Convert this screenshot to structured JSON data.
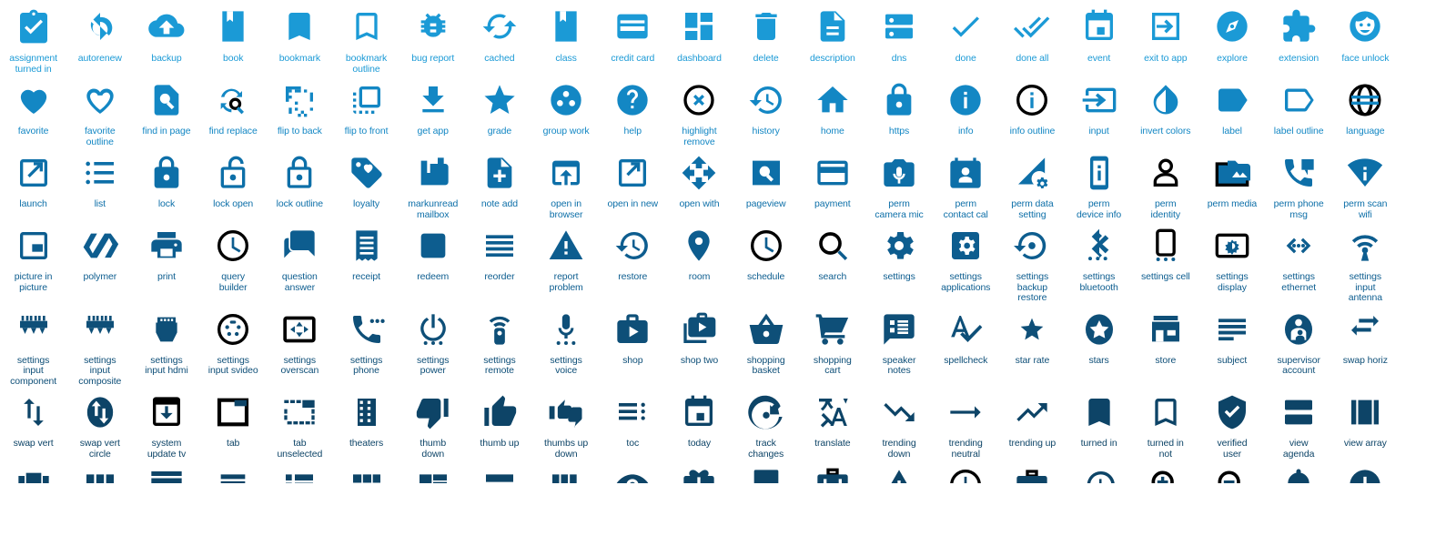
{
  "sheet": {
    "title": "Icon set reference sheet",
    "columns": 21,
    "accent_top": "#1b9ad6",
    "accent_bottom": "#0d4467",
    "background": "#ffffff"
  },
  "rows": [
    {
      "index": 0,
      "color": "#1b9ad6",
      "icons": [
        {
          "name": "assignment-turned-in",
          "label": "assignment\nturned in",
          "glyph": "clipboard-check"
        },
        {
          "name": "autorenew",
          "label": "autorenew",
          "glyph": "autorenew"
        },
        {
          "name": "backup",
          "label": "backup",
          "glyph": "cloud-upload"
        },
        {
          "name": "book",
          "label": "book",
          "glyph": "book"
        },
        {
          "name": "bookmark",
          "label": "bookmark",
          "glyph": "bookmark"
        },
        {
          "name": "bookmark-outline",
          "label": "bookmark\noutline",
          "glyph": "bookmark-outline"
        },
        {
          "name": "bug-report",
          "label": "bug report",
          "glyph": "bug"
        },
        {
          "name": "cached",
          "label": "cached",
          "glyph": "cached"
        },
        {
          "name": "class",
          "label": "class",
          "glyph": "book"
        },
        {
          "name": "credit-card",
          "label": "credit card",
          "glyph": "credit-card"
        },
        {
          "name": "dashboard",
          "label": "dashboard",
          "glyph": "dashboard"
        },
        {
          "name": "delete",
          "label": "delete",
          "glyph": "trash"
        },
        {
          "name": "description",
          "label": "description",
          "glyph": "document"
        },
        {
          "name": "dns",
          "label": "dns",
          "glyph": "dns"
        },
        {
          "name": "done",
          "label": "done",
          "glyph": "check"
        },
        {
          "name": "done-all",
          "label": "done all",
          "glyph": "check-double"
        },
        {
          "name": "event",
          "label": "event",
          "glyph": "calendar-event"
        },
        {
          "name": "exit-to-app",
          "label": "exit to app",
          "glyph": "exit-to-app"
        },
        {
          "name": "explore",
          "label": "explore",
          "glyph": "compass"
        },
        {
          "name": "extension",
          "label": "extension",
          "glyph": "puzzle"
        },
        {
          "name": "face-unlock",
          "label": "face unlock",
          "glyph": "face"
        }
      ]
    },
    {
      "index": 1,
      "color": "#1387c4",
      "icons": [
        {
          "name": "favorite",
          "label": "favorite",
          "glyph": "heart"
        },
        {
          "name": "favorite-outline",
          "label": "favorite\noutline",
          "glyph": "heart-outline"
        },
        {
          "name": "find-in-page",
          "label": "find in page",
          "glyph": "find-in-page"
        },
        {
          "name": "find-replace",
          "label": "find replace",
          "glyph": "find-replace"
        },
        {
          "name": "flip-to-back",
          "label": "flip to back",
          "glyph": "flip-to-back"
        },
        {
          "name": "flip-to-front",
          "label": "flip to front",
          "glyph": "flip-to-front"
        },
        {
          "name": "get-app",
          "label": "get app",
          "glyph": "download"
        },
        {
          "name": "grade",
          "label": "grade",
          "glyph": "star"
        },
        {
          "name": "group-work",
          "label": "group work",
          "glyph": "group-work"
        },
        {
          "name": "help",
          "label": "help",
          "glyph": "help"
        },
        {
          "name": "highlight-remove",
          "label": "highlight\nremove",
          "glyph": "highlight-remove"
        },
        {
          "name": "history",
          "label": "history",
          "glyph": "history"
        },
        {
          "name": "home",
          "label": "home",
          "glyph": "home"
        },
        {
          "name": "https",
          "label": "https",
          "glyph": "lock"
        },
        {
          "name": "info",
          "label": "info",
          "glyph": "info"
        },
        {
          "name": "info-outline",
          "label": "info outline",
          "glyph": "info-outline"
        },
        {
          "name": "input",
          "label": "input",
          "glyph": "input"
        },
        {
          "name": "invert-colors",
          "label": "invert colors",
          "glyph": "invert-colors"
        },
        {
          "name": "label",
          "label": "label",
          "glyph": "label"
        },
        {
          "name": "label-outline",
          "label": "label outline",
          "glyph": "label-outline"
        },
        {
          "name": "language",
          "label": "language",
          "glyph": "globe"
        }
      ]
    },
    {
      "index": 2,
      "color": "#0d6fa8",
      "icons": [
        {
          "name": "launch",
          "label": "launch",
          "glyph": "launch"
        },
        {
          "name": "list",
          "label": "list",
          "glyph": "list"
        },
        {
          "name": "lock",
          "label": "lock",
          "glyph": "lock"
        },
        {
          "name": "lock-open",
          "label": "lock open",
          "glyph": "lock-open"
        },
        {
          "name": "lock-outline",
          "label": "lock outline",
          "glyph": "lock-outline"
        },
        {
          "name": "loyalty",
          "label": "loyalty",
          "glyph": "loyalty"
        },
        {
          "name": "markunread-mailbox",
          "label": "markunread\nmailbox",
          "glyph": "mailbox"
        },
        {
          "name": "note-add",
          "label": "note add",
          "glyph": "note-add"
        },
        {
          "name": "open-in-browser",
          "label": "open in\nbrowser",
          "glyph": "open-in-browser"
        },
        {
          "name": "open-in-new",
          "label": "open in new",
          "glyph": "open-in-new"
        },
        {
          "name": "open-with",
          "label": "open with",
          "glyph": "open-with"
        },
        {
          "name": "pageview",
          "label": "pageview",
          "glyph": "pageview"
        },
        {
          "name": "payment",
          "label": "payment",
          "glyph": "credit-card-outline"
        },
        {
          "name": "perm-camera-mic",
          "label": "perm\ncamera mic",
          "glyph": "camera-mic"
        },
        {
          "name": "perm-contact-cal",
          "label": "perm\ncontact cal",
          "glyph": "contact-calendar"
        },
        {
          "name": "perm-data-setting",
          "label": "perm data\nsetting",
          "glyph": "data-setting"
        },
        {
          "name": "perm-device-info",
          "label": "perm\ndevice info",
          "glyph": "device-info"
        },
        {
          "name": "perm-identity",
          "label": "perm\nidentity",
          "glyph": "person-outline"
        },
        {
          "name": "perm-media",
          "label": "perm media",
          "glyph": "perm-media"
        },
        {
          "name": "perm-phone-msg",
          "label": "perm phone\nmsg",
          "glyph": "phone-msg"
        },
        {
          "name": "perm-scan-wifi",
          "label": "perm scan\nwifi",
          "glyph": "scan-wifi"
        }
      ]
    },
    {
      "index": 3,
      "color": "#0d5d8f",
      "icons": [
        {
          "name": "picture-in-picture",
          "label": "picture in\npicture",
          "glyph": "picture-in-picture"
        },
        {
          "name": "polymer",
          "label": "polymer",
          "glyph": "polymer"
        },
        {
          "name": "print",
          "label": "print",
          "glyph": "print"
        },
        {
          "name": "query-builder",
          "label": "query\nbuilder",
          "glyph": "clock-outline"
        },
        {
          "name": "question-answer",
          "label": "question\nanswer",
          "glyph": "question-answer"
        },
        {
          "name": "receipt",
          "label": "receipt",
          "glyph": "receipt"
        },
        {
          "name": "redeem",
          "label": "redeem",
          "glyph": "redeem"
        },
        {
          "name": "reorder",
          "label": "reorder",
          "glyph": "reorder"
        },
        {
          "name": "report-problem",
          "label": "report\nproblem",
          "glyph": "warning"
        },
        {
          "name": "restore",
          "label": "restore",
          "glyph": "history"
        },
        {
          "name": "room",
          "label": "room",
          "glyph": "place"
        },
        {
          "name": "schedule",
          "label": "schedule",
          "glyph": "clock-outline"
        },
        {
          "name": "search",
          "label": "search",
          "glyph": "search"
        },
        {
          "name": "settings",
          "label": "settings",
          "glyph": "gear"
        },
        {
          "name": "settings-applications",
          "label": "settings\napplications",
          "glyph": "gear-box"
        },
        {
          "name": "settings-backup-restore",
          "label": "settings\nbackup\nrestore",
          "glyph": "backup-restore"
        },
        {
          "name": "settings-bluetooth",
          "label": "settings\nbluetooth",
          "glyph": "bluetooth-dots"
        },
        {
          "name": "settings-cell",
          "label": "settings cell",
          "glyph": "cell-dots"
        },
        {
          "name": "settings-display",
          "label": "settings\ndisplay",
          "glyph": "display-brightness"
        },
        {
          "name": "settings-ethernet",
          "label": "settings\nethernet",
          "glyph": "ethernet"
        },
        {
          "name": "settings-input-antenna",
          "label": "settings\ninput\nantenna",
          "glyph": "antenna"
        }
      ]
    },
    {
      "index": 4,
      "color": "#0e4f78",
      "icons": [
        {
          "name": "settings-input-component",
          "label": "settings\ninput\ncomponent",
          "glyph": "plugs"
        },
        {
          "name": "settings-input-composite",
          "label": "settings\ninput\ncomposite",
          "glyph": "plugs"
        },
        {
          "name": "settings-input-hdmi",
          "label": "settings\ninput hdmi",
          "glyph": "hdmi"
        },
        {
          "name": "settings-input-svideo",
          "label": "settings\ninput svideo",
          "glyph": "svideo"
        },
        {
          "name": "settings-overscan",
          "label": "settings\noverscan",
          "glyph": "overscan"
        },
        {
          "name": "settings-phone",
          "label": "settings\nphone",
          "glyph": "phone-dots"
        },
        {
          "name": "settings-power",
          "label": "settings\npower",
          "glyph": "power-dots"
        },
        {
          "name": "settings-remote",
          "label": "settings\nremote",
          "glyph": "remote"
        },
        {
          "name": "settings-voice",
          "label": "settings\nvoice",
          "glyph": "mic-dots"
        },
        {
          "name": "shop",
          "label": "shop",
          "glyph": "shop"
        },
        {
          "name": "shop-two",
          "label": "shop two",
          "glyph": "shop-two"
        },
        {
          "name": "shopping-basket",
          "label": "shopping\nbasket",
          "glyph": "basket"
        },
        {
          "name": "shopping-cart",
          "label": "shopping\ncart",
          "glyph": "cart"
        },
        {
          "name": "speaker-notes",
          "label": "speaker\nnotes",
          "glyph": "speaker-notes"
        },
        {
          "name": "spellcheck",
          "label": "spellcheck",
          "glyph": "spellcheck"
        },
        {
          "name": "star-rate",
          "label": "star rate",
          "glyph": "star-small"
        },
        {
          "name": "stars",
          "label": "stars",
          "glyph": "stars"
        },
        {
          "name": "store",
          "label": "store",
          "glyph": "store"
        },
        {
          "name": "subject",
          "label": "subject",
          "glyph": "subject"
        },
        {
          "name": "supervisor-account",
          "label": "supervisor\naccount",
          "glyph": "supervisor"
        },
        {
          "name": "swap-horiz",
          "label": "swap horiz",
          "glyph": "swap-horiz"
        }
      ]
    },
    {
      "index": 5,
      "color": "#0d4467",
      "icons": [
        {
          "name": "swap-vert",
          "label": "swap vert",
          "glyph": "swap-vert"
        },
        {
          "name": "swap-vert-circle",
          "label": "swap vert\ncircle",
          "glyph": "swap-vert-circle"
        },
        {
          "name": "system-update-tv",
          "label": "system\nupdate tv",
          "glyph": "system-update"
        },
        {
          "name": "tab",
          "label": "tab",
          "glyph": "tab"
        },
        {
          "name": "tab-unselected",
          "label": "tab\nunselected",
          "glyph": "tab-unselected"
        },
        {
          "name": "theaters",
          "label": "theaters",
          "glyph": "theaters"
        },
        {
          "name": "thumb-down",
          "label": "thumb\ndown",
          "glyph": "thumb-down"
        },
        {
          "name": "thumb-up",
          "label": "thumb up",
          "glyph": "thumb-up"
        },
        {
          "name": "thumbs-up-down",
          "label": "thumbs up\ndown",
          "glyph": "thumbs-up-down"
        },
        {
          "name": "toc",
          "label": "toc",
          "glyph": "toc"
        },
        {
          "name": "today",
          "label": "today",
          "glyph": "calendar-event"
        },
        {
          "name": "track-changes",
          "label": "track\nchanges",
          "glyph": "track-changes"
        },
        {
          "name": "translate",
          "label": "translate",
          "glyph": "translate"
        },
        {
          "name": "trending-down",
          "label": "trending\ndown",
          "glyph": "trending-down"
        },
        {
          "name": "trending-neutral",
          "label": "trending\nneutral",
          "glyph": "trending-neutral"
        },
        {
          "name": "trending-up",
          "label": "trending up",
          "glyph": "trending-up"
        },
        {
          "name": "turned-in",
          "label": "turned in",
          "glyph": "bookmark"
        },
        {
          "name": "turned-in-not",
          "label": "turned in\nnot",
          "glyph": "bookmark-outline"
        },
        {
          "name": "verified-user",
          "label": "verified\nuser",
          "glyph": "verified-user"
        },
        {
          "name": "view-agenda",
          "label": "view\nagenda",
          "glyph": "view-agenda"
        },
        {
          "name": "view-array",
          "label": "view array",
          "glyph": "view-array"
        }
      ]
    },
    {
      "index": 6,
      "color": "#0d4467",
      "clipped": true,
      "icons": [
        {
          "name": "view-carousel",
          "label": "",
          "glyph": "view-carousel"
        },
        {
          "name": "view-column",
          "label": "",
          "glyph": "view-column"
        },
        {
          "name": "view-day",
          "label": "",
          "glyph": "view-day"
        },
        {
          "name": "view-headline",
          "label": "",
          "glyph": "view-headline"
        },
        {
          "name": "view-list",
          "label": "",
          "glyph": "view-list"
        },
        {
          "name": "view-module",
          "label": "",
          "glyph": "view-module"
        },
        {
          "name": "view-quilt",
          "label": "",
          "glyph": "view-quilt"
        },
        {
          "name": "view-stream",
          "label": "",
          "glyph": "view-stream"
        },
        {
          "name": "view-week",
          "label": "",
          "glyph": "view-week"
        },
        {
          "name": "visibility",
          "label": "",
          "glyph": "visibility"
        },
        {
          "name": "wallet-giftcard",
          "label": "",
          "glyph": "wallet-giftcard"
        },
        {
          "name": "wallet-membership",
          "label": "",
          "glyph": "wallet-membership"
        },
        {
          "name": "wallet-travel",
          "label": "",
          "glyph": "wallet-travel"
        },
        {
          "name": "warning",
          "label": "",
          "glyph": "warning"
        },
        {
          "name": "watch-later",
          "label": "",
          "glyph": "clock-outline"
        },
        {
          "name": "work",
          "label": "",
          "glyph": "work"
        },
        {
          "name": "youtube-searched-for",
          "label": "",
          "glyph": "history"
        },
        {
          "name": "zoom-in",
          "label": "",
          "glyph": "zoom-in"
        },
        {
          "name": "zoom-out",
          "label": "",
          "glyph": "zoom-out"
        },
        {
          "name": "add-alert",
          "label": "",
          "glyph": "add-alert"
        },
        {
          "name": "error",
          "label": "",
          "glyph": "error"
        }
      ]
    }
  ]
}
